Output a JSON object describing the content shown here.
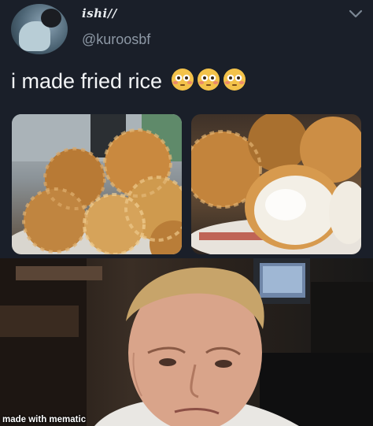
{
  "tweet": {
    "display_name": "ishi//",
    "handle": "@kuroosbf",
    "text": "i made fried rice",
    "emoji_count": 3,
    "emoji_name": "flushed-face",
    "media": [
      {
        "depicts": "fried-dough-balls"
      },
      {
        "depicts": "broken-open-dough-ball"
      }
    ]
  },
  "reaction": {
    "depicts": "chef-unimpressed-face",
    "watermark": "made with mematic"
  },
  "colors": {
    "tweet_bg": "#1a1f29",
    "text_primary": "#f2f4f6",
    "text_secondary": "#8d98a5"
  }
}
